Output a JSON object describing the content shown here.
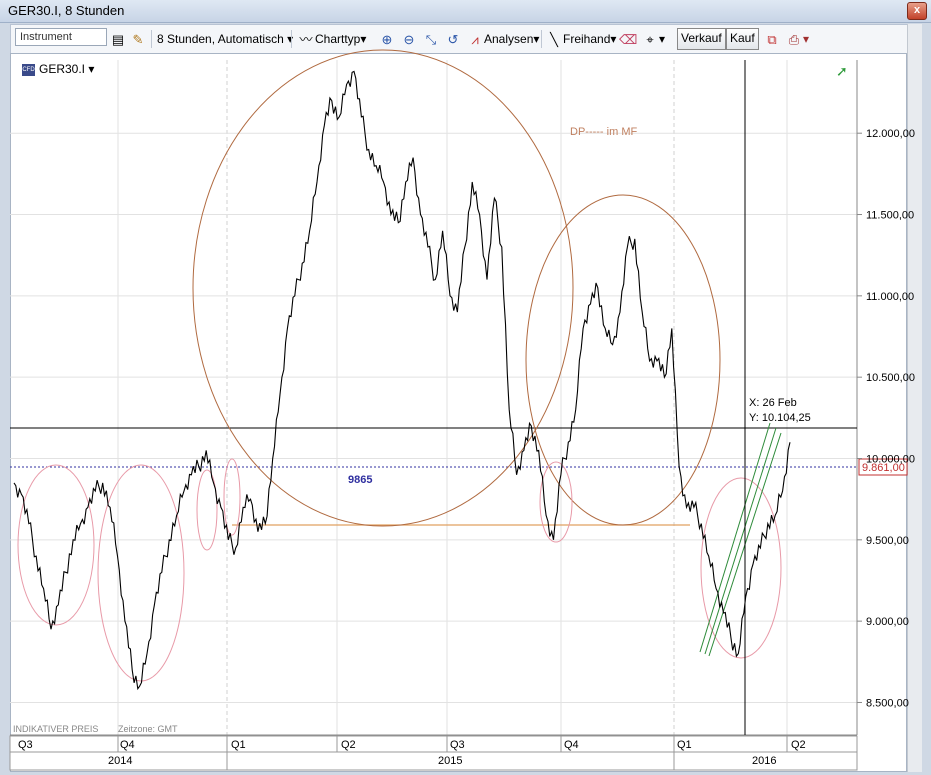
{
  "window": {
    "title": "GER30.I, 8 Stunden",
    "close_label": "x"
  },
  "toolbar": {
    "instrument_placeholder": "Instrument",
    "timeframe_label": "8 Stunden,",
    "mode_label": "Automatisch",
    "charttype_label": "Charttyp",
    "analyses_label": "Analysen",
    "freehand_label": "Freihand",
    "sell_label": "Verkauf",
    "buy_label": "Kauf"
  },
  "chart_header": {
    "symbol": "GER30.I"
  },
  "annotations": {
    "dp_note": "DP----- im MF",
    "level_label": "9865",
    "price_tag": "9.861,00",
    "crosshair_x": "X: 26 Feb",
    "crosshair_y": "Y: 10.104,25",
    "indicative": "INDIKATIVER PREIS",
    "timezone": "Zeitzone: GMT"
  },
  "chart_data": {
    "type": "line",
    "y_axis_ticks": [
      "12.000,00",
      "11.500,00",
      "11.000,00",
      "10.500,00",
      "10.000,00",
      "9.500,00",
      "9.000,00",
      "8.500,00"
    ],
    "y_tick_values": [
      12000,
      11500,
      11000,
      10500,
      10000,
      9500,
      9000,
      8500
    ],
    "ylim": [
      8300,
      12450
    ],
    "quarters": [
      "Q3",
      "Q4",
      "Q1",
      "Q2",
      "Q3",
      "Q4",
      "Q1",
      "Q2"
    ],
    "years": [
      "2014",
      "2015",
      "2016"
    ],
    "horizontal_levels": [
      10104.25,
      9865,
      9500
    ],
    "series": [
      {
        "values": [
          9850,
          9780,
          9600,
          9400,
          9200,
          8950,
          9100,
          9300,
          9500,
          9600,
          9700,
          9800,
          9850,
          9700,
          9400,
          9000,
          8700,
          8600,
          8800,
          9100,
          9300,
          9500,
          9650,
          9800,
          9900,
          9950,
          10050,
          9850,
          9700,
          9500,
          9450,
          9700,
          9750,
          9550,
          9600,
          10000,
          10400,
          10800,
          11000,
          11200,
          11400,
          11700,
          12050,
          12200,
          12100,
          12300,
          12380,
          12100,
          11900,
          11800,
          11700,
          11500,
          11450,
          11700,
          11850,
          11500,
          11300,
          11100,
          11400,
          11000,
          10900,
          11300,
          11700,
          11500,
          11100,
          11600,
          11300,
          10300,
          9900,
          10050,
          10200,
          10050,
          9650,
          9500,
          9900,
          10100,
          10300,
          10800,
          10950,
          11050,
          10800,
          10700,
          10900,
          11300,
          11350,
          10900,
          10600,
          10600,
          10500,
          10800,
          9950,
          9700,
          9700,
          9600,
          9400,
          9200,
          9050,
          8900,
          8800,
          9150,
          9350,
          9450,
          9600,
          9650,
          9800,
          10100
        ]
      }
    ]
  }
}
